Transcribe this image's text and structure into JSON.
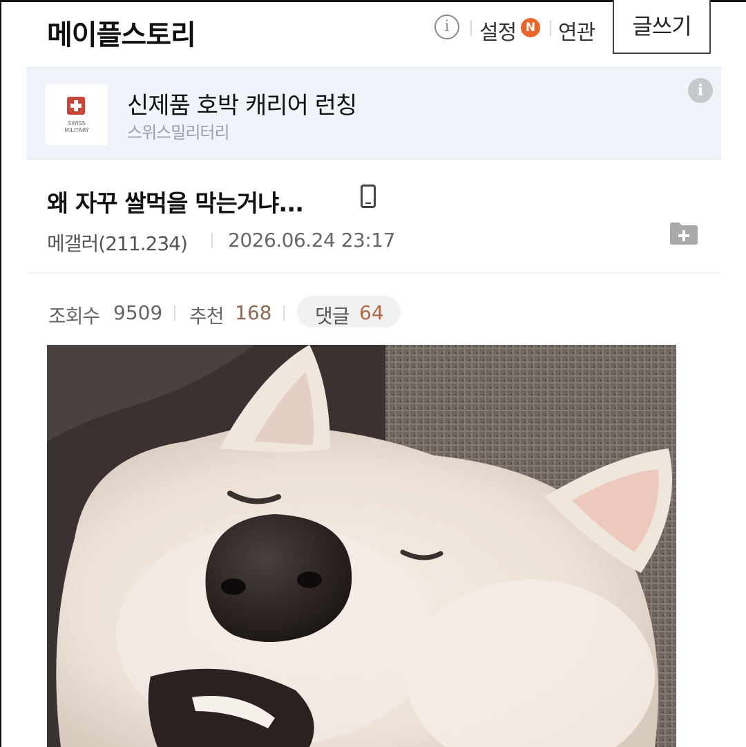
{
  "header": {
    "brand": "메이플스토리",
    "info_icon": "info-icon",
    "settings_label": "설정",
    "new_badge": "N",
    "related_label": "연관",
    "write_label": "글쓰기"
  },
  "ad": {
    "logo_text_line1": "SWISS",
    "logo_text_line2": "MILITARY",
    "title": "신제품 호박 캐리어 런칭",
    "advertiser": "스위스밀리터리",
    "info_icon": "info-icon"
  },
  "post": {
    "title": "왜 자꾸 쌀먹을 막는거냐...",
    "device_icon": "mobile-icon",
    "author": "메갤러(211.234)",
    "datetime": "2026.06.24 23:17",
    "folder_icon": "folder-add-icon"
  },
  "stats": {
    "views_label": "조회수",
    "views": "9509",
    "recommend_label": "추천",
    "recommend": "168",
    "comments_label": "댓글",
    "comments": "64"
  },
  "colors": {
    "badge": "#e8662c",
    "ad_bg": "#eef4fa",
    "comment_count": "#b06a45"
  }
}
